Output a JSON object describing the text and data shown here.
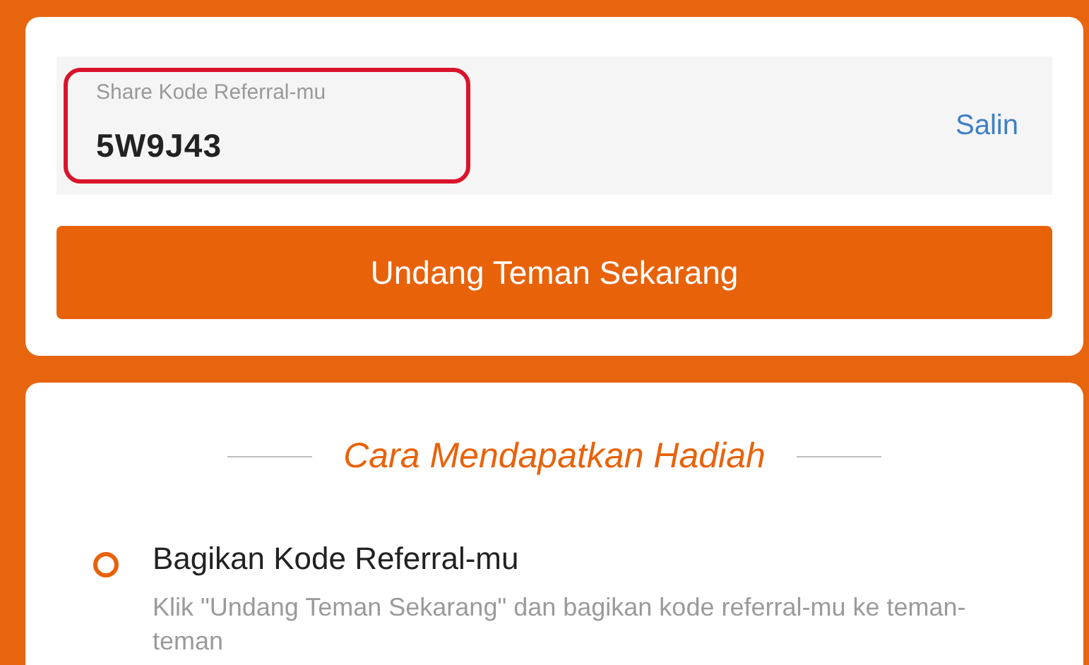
{
  "referral": {
    "label": "Share Kode Referral-mu",
    "code": "5W9J43",
    "highlighted": true,
    "copy_label": "Salin"
  },
  "invite_button": "Undang Teman Sekarang",
  "how_to": {
    "title": "Cara Mendapatkan Hadiah",
    "steps": [
      {
        "title": "Bagikan Kode Referral-mu",
        "description": "Klik \"Undang Teman Sekarang\" dan bagikan kode referral-mu ke teman-teman"
      }
    ]
  }
}
